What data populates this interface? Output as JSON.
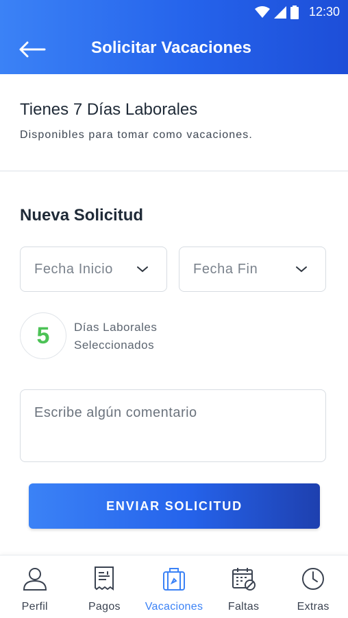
{
  "status_bar": {
    "time": "12:30"
  },
  "header": {
    "title": "Solicitar Vacaciones"
  },
  "info": {
    "title": "Tienes 7 Días Laborales",
    "subtitle": "Disponibles para tomar como vacaciones."
  },
  "request": {
    "title": "Nueva Solicitud",
    "start_date_label": "Fecha Inicio",
    "end_date_label": "Fecha Fin",
    "selected_days_count": "5",
    "selected_days_line1": "Días Laborales",
    "selected_days_line2": "Seleccionados",
    "comment_placeholder": "Escribe algún comentario",
    "submit_label": "ENVIAR SOLICITUD"
  },
  "nav": {
    "items": [
      {
        "label": "Perfil",
        "icon": "user-icon",
        "active": false
      },
      {
        "label": "Pagos",
        "icon": "receipt-icon",
        "active": false
      },
      {
        "label": "Vacaciones",
        "icon": "suitcase-icon",
        "active": true
      },
      {
        "label": "Faltas",
        "icon": "calendar-blocked-icon",
        "active": false
      },
      {
        "label": "Extras",
        "icon": "clock-icon",
        "active": false
      }
    ]
  },
  "colors": {
    "primary": "#2563eb",
    "accent_green": "#4cc256",
    "text_dark": "#1f2a37"
  }
}
